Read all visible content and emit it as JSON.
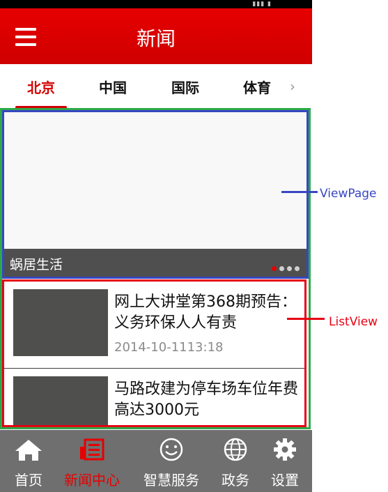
{
  "header": {
    "title": "新闻"
  },
  "tabs": [
    "北京",
    "中国",
    "国际",
    "体育"
  ],
  "viewpager": {
    "caption": "蜗居生活"
  },
  "news": [
    {
      "title": "网上大讲堂第368期预告：义务环保人人有责",
      "date": "2014-10-1113:18"
    },
    {
      "title": "马路改建为停车场车位年费高达3000元",
      "date": ""
    }
  ],
  "bottom_nav": [
    "首页",
    "新闻中心",
    "智慧服务",
    "政务",
    "设置"
  ],
  "annotations": {
    "viewpager": "ViewPage",
    "listview": "ListView"
  },
  "colors": {
    "brand_red": "#e60000",
    "green_frame": "#2ea84a",
    "blue_frame": "#3747c2",
    "red_frame": "#e60012"
  }
}
